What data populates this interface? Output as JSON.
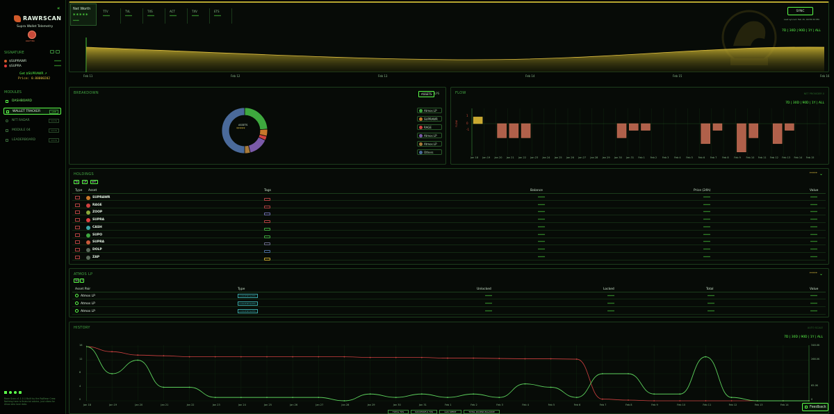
{
  "app": {
    "title": "RAWRSCAN",
    "subtitle": "Supra Wallet Telemetry",
    "avatar_label": "DRIFTER"
  },
  "sidebar": {
    "signature_label": "SIGNATURE",
    "signatures": [
      {
        "name": "$SUPRAWR",
        "value": "*****"
      },
      {
        "name": "$SUPRA",
        "value": "*****"
      }
    ],
    "get_label": "Get $SUPRAWR ↗",
    "price_label": "Price: 0.00000202",
    "modules_label": "MODULES",
    "nav": [
      {
        "label": "DASHBOARD",
        "badge": ""
      },
      {
        "label": "WALLET TRACKER",
        "badge": "LIVE"
      },
      {
        "label": "NFT RADAR",
        "badge": "SOON"
      },
      {
        "label": "MODULE 04",
        "badge": "SOON"
      },
      {
        "label": "LEADERBOARD",
        "badge": "SOON"
      }
    ],
    "footer": "Rawr Scan v1.1.0 // Built by the RajRawr Crew. Nothing here is financial advice, just vibes for dinos who love data."
  },
  "networth": {
    "label": "Net Worth",
    "value": "*****",
    "sub": "*****",
    "stats": [
      {
        "label": "TTV",
        "value": "*****"
      },
      {
        "label": "TVL",
        "value": "*****"
      },
      {
        "label": "TXS",
        "value": "*****"
      },
      {
        "label": "ACT",
        "value": "*****"
      },
      {
        "label": "TXV",
        "value": "*****"
      },
      {
        "label": "ETS",
        "value": "*****"
      }
    ],
    "sync_label": "SYNC",
    "sync_sub": "Last synced: Feb 15, 09:55:53 PM",
    "timeframes": "7D | 30D | 90D | 1Y | ALL",
    "x_labels": [
      "Feb 11",
      "Feb 12",
      "Feb 13",
      "Feb 14",
      "Feb 15",
      "Feb 16"
    ]
  },
  "breakdown": {
    "title": "BREAKDOWN",
    "tab_assets": "ASSETS",
    "tab_lps": "LPS",
    "center_label": "ASSETS",
    "center_value": "*****",
    "legend": [
      {
        "label": "Atmos LP",
        "color": "#3ea83e"
      },
      {
        "label": "SUPRAWR",
        "color": "#c8782a"
      },
      {
        "label": "RAGE",
        "color": "#d04040"
      },
      {
        "label": "Atmos LP",
        "color": "#7a5aa8"
      },
      {
        "label": "Atmos LP",
        "color": "#a87a3a"
      },
      {
        "label": "Others",
        "color": "#4a6a9a"
      }
    ]
  },
  "flow": {
    "title": "FLOW",
    "legend_hint": "FLOW",
    "top_right": "NET PROVIDER 0",
    "timeframes": "7D | 30D | 90D | 1Y | ALL",
    "x_labels": [
      "Jan 18",
      "Jan 19",
      "Jan 20",
      "Jan 21",
      "Jan 22",
      "Jan 23",
      "Jan 24",
      "Jan 25",
      "Jan 26",
      "Jan 27",
      "Jan 28",
      "Jan 29",
      "Jan 30",
      "Jan 31",
      "Feb 1",
      "Feb 2",
      "Feb 3",
      "Feb 4",
      "Feb 5",
      "Feb 6",
      "Feb 7",
      "Feb 8",
      "Feb 9",
      "Feb 10",
      "Feb 11",
      "Feb 12",
      "Feb 13",
      "Feb 14",
      "Feb 15"
    ],
    "y_labels": [
      "1",
      "0",
      "-1"
    ],
    "values": [
      0.8,
      0,
      -1.7,
      -1.7,
      -1.7,
      0,
      0,
      0,
      0,
      0,
      0,
      0,
      -1.7,
      -0.8,
      -0.8,
      0,
      0,
      0,
      0,
      -2.4,
      -0.8,
      0,
      -3.4,
      -1.7,
      0,
      -2.4,
      -0.8,
      0,
      0
    ]
  },
  "holdings": {
    "title": "HOLDINGS",
    "value": "*****",
    "filters": [
      "TK",
      "LP",
      "NFT"
    ],
    "columns": [
      "Type",
      "Asset",
      "Tags",
      "Balance",
      "Price (24h)",
      "Value"
    ],
    "rows": [
      {
        "type": "TK",
        "asset": "SUPRAWR",
        "color": "#c8782a",
        "balance": "*****",
        "price": "*****",
        "value": "*****"
      },
      {
        "type": "TK",
        "asset": "RAGE",
        "color": "#d04040",
        "balance": "*****",
        "price": "*****",
        "value": "*****"
      },
      {
        "type": "TK",
        "asset": "ZOOP",
        "color": "#8aa83a",
        "balance": "*****",
        "price": "*****",
        "value": "*****"
      },
      {
        "type": "TK",
        "asset": "SUPRA",
        "color": "#e04040",
        "balance": "*****",
        "price": "*****",
        "value": "*****"
      },
      {
        "type": "TK",
        "asset": "CASH",
        "color": "#3aa8a8",
        "balance": "*****",
        "price": "*****",
        "value": "*****"
      },
      {
        "type": "TK",
        "asset": "SUPO",
        "color": "#3ea83e",
        "balance": "*****",
        "price": "*****",
        "value": "*****"
      },
      {
        "type": "TK",
        "asset": "SUPRA",
        "color": "#c85a3a",
        "balance": "*****",
        "price": "*****",
        "value": "*****"
      },
      {
        "type": "TK",
        "asset": "DOLP",
        "color": "#5a6a5a",
        "balance": "*****",
        "price": "*****",
        "value": "*****"
      },
      {
        "type": "TK",
        "asset": "ZAP",
        "color": "#5a6a5a",
        "balance": "*****",
        "price": "*****",
        "value": "*****"
      }
    ]
  },
  "atmos": {
    "title": "ATMOS LP",
    "value": "*****",
    "filters": [
      "30",
      "7"
    ],
    "columns": [
      "Asset Pair",
      "Type",
      "Unlocked",
      "Locked",
      "Total",
      "Value"
    ],
    "rows": [
      {
        "pair": "Atmos LP",
        "type": "CONCENTRATED",
        "unlocked": "*****",
        "locked": "*****",
        "total": "*****",
        "value": "*****"
      },
      {
        "pair": "Atmos LP",
        "type": "CONCENTRATED",
        "unlocked": "*****",
        "locked": "*****",
        "total": "*****",
        "value": "*****"
      },
      {
        "pair": "Atmos LP",
        "type": "CONCENTRATED",
        "unlocked": "*****",
        "locked": "*****",
        "total": "*****",
        "value": "*****"
      }
    ]
  },
  "history": {
    "title": "HISTORY",
    "top_right": "AUTO SCALE",
    "timeframes": "7D | 30D | 90D | 1Y | ALL",
    "y_left": [
      "16",
      "12",
      "8",
      "4",
      "0"
    ],
    "y_right": [
      "348.0K",
      "268.0K",
      "65.0K",
      "0"
    ],
    "x_labels": [
      "Jan 18",
      "Jan 19",
      "Jan 20",
      "Jan 21",
      "Jan 22",
      "Jan 23",
      "Jan 24",
      "Jan 25",
      "Jan 26",
      "Jan 27",
      "Jan 28",
      "Jan 29",
      "Jan 30",
      "Jan 31",
      "Feb 1",
      "Feb 2",
      "Feb 3",
      "Feb 4",
      "Feb 5",
      "Feb 6",
      "Feb 7",
      "Feb 8",
      "Feb 9",
      "Feb 10",
      "Feb 11",
      "Feb 12",
      "Feb 13",
      "Feb 14",
      "Feb 15"
    ],
    "legend": [
      "TOTAL TXS",
      "SUCCESSFUL TXS",
      "GAS SPENT",
      "TOTAL $SUPRA BALANCE"
    ],
    "feedback": "Feedback"
  },
  "chart_data": [
    {
      "type": "area",
      "title": "Net Worth",
      "x": [
        "Feb 11",
        "Feb 12",
        "Feb 13",
        "Feb 14",
        "Feb 15",
        "Feb 16"
      ]
    },
    {
      "type": "pie",
      "title": "BREAKDOWN",
      "categories": [
        "Atmos LP",
        "SUPRAWR",
        "RAGE",
        "Atmos LP",
        "Atmos LP",
        "Others"
      ],
      "values": [
        24,
        5,
        3,
        14,
        4,
        50
      ]
    },
    {
      "type": "bar",
      "title": "FLOW",
      "categories": [
        "Jan 18",
        "Jan 19",
        "Jan 20",
        "Jan 21",
        "Jan 22",
        "Jan 23",
        "Jan 24",
        "Jan 25",
        "Jan 26",
        "Jan 27",
        "Jan 28",
        "Jan 29",
        "Jan 30",
        "Jan 31",
        "Feb 1",
        "Feb 2",
        "Feb 3",
        "Feb 4",
        "Feb 5",
        "Feb 6",
        "Feb 7",
        "Feb 8",
        "Feb 9",
        "Feb 10",
        "Feb 11",
        "Feb 12",
        "Feb 13",
        "Feb 14",
        "Feb 15"
      ],
      "values": [
        0.8,
        0,
        -1.7,
        -1.7,
        -1.7,
        0,
        0,
        0,
        0,
        0,
        0,
        0,
        -1.7,
        -0.8,
        -0.8,
        0,
        0,
        0,
        0,
        -2.4,
        -0.8,
        0,
        -3.4,
        -1.7,
        0,
        -2.4,
        -0.8,
        0,
        0
      ]
    },
    {
      "type": "line",
      "title": "HISTORY",
      "x": [
        "Jan 18",
        "Jan 19",
        "Jan 20",
        "Jan 21",
        "Jan 22",
        "Jan 23",
        "Jan 24",
        "Jan 25",
        "Jan 26",
        "Jan 27",
        "Jan 28",
        "Jan 29",
        "Jan 30",
        "Jan 31",
        "Feb 1",
        "Feb 2",
        "Feb 3",
        "Feb 4",
        "Feb 5",
        "Feb 6",
        "Feb 7",
        "Feb 8",
        "Feb 9",
        "Feb 10",
        "Feb 11",
        "Feb 12",
        "Feb 13",
        "Feb 14",
        "Feb 15"
      ],
      "series": [
        {
          "name": "TOTAL TXS",
          "values": [
            16,
            8,
            12,
            4,
            4,
            1,
            1,
            1,
            1,
            1,
            0,
            2,
            1,
            2,
            1,
            2,
            1,
            5,
            4,
            1,
            8,
            8,
            2,
            2,
            13,
            1,
            0,
            0,
            0
          ]
        },
        {
          "name": "TOTAL $SUPRA BALANCE",
          "values": [
            16,
            14.5,
            13.5,
            13.3,
            13,
            13,
            13,
            13,
            13,
            13,
            13,
            12.8,
            12.8,
            12.8,
            12.6,
            12.6,
            12.5,
            12.4,
            12.4,
            12.3,
            0.5,
            0.2,
            0,
            0,
            0,
            0,
            0,
            0,
            0
          ]
        }
      ]
    }
  ]
}
